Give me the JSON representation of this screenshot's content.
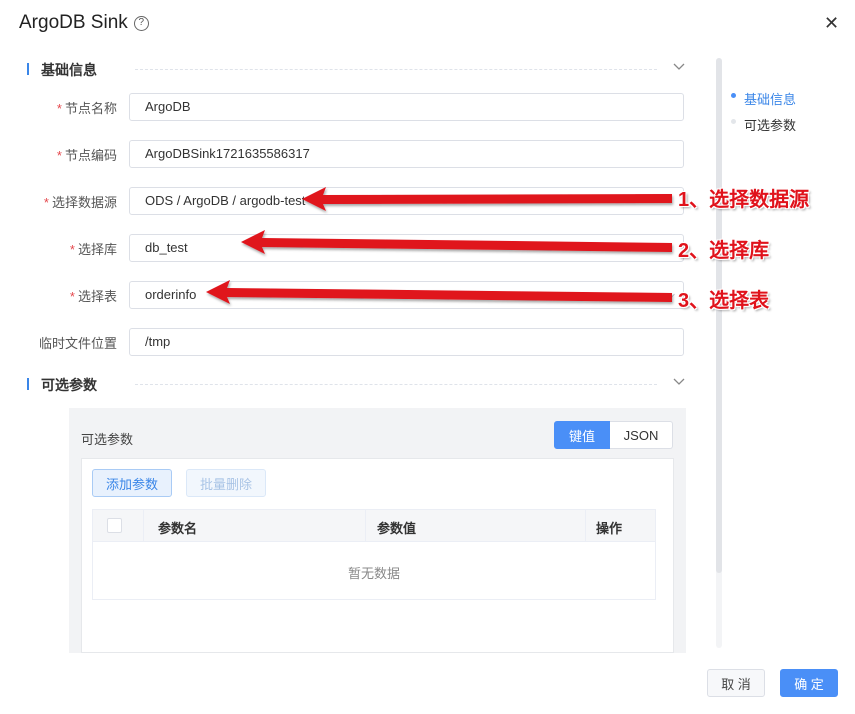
{
  "dialog": {
    "title": "ArgoDB Sink",
    "help_icon": "question-circle-icon",
    "close_icon": "close-icon"
  },
  "sections": {
    "basic": {
      "title": "基础信息"
    },
    "optional": {
      "title": "可选参数"
    }
  },
  "form": {
    "node_name": {
      "label": "节点名称",
      "required": true,
      "value": "ArgoDB"
    },
    "node_code": {
      "label": "节点编码",
      "required": true,
      "value": "ArgoDBSink1721635586317"
    },
    "datasource": {
      "label": "选择数据源",
      "required": true,
      "value": "ODS / ArgoDB / argodb-test"
    },
    "database": {
      "label": "选择库",
      "required": true,
      "value": "db_test"
    },
    "table": {
      "label": "选择表",
      "required": true,
      "value": "orderinfo"
    },
    "temp_path": {
      "label": "临时文件位置",
      "required": false,
      "value": "/tmp"
    }
  },
  "params_panel": {
    "title": "可选参数",
    "mode_keyvalue": "键值",
    "mode_json": "JSON",
    "add_button": "添加参数",
    "batch_delete_button": "批量删除",
    "columns": [
      "参数名",
      "参数值",
      "操作"
    ],
    "empty_text": "暂无数据"
  },
  "anchor_nav": {
    "items": [
      {
        "label": "基础信息",
        "active": true
      },
      {
        "label": "可选参数",
        "active": false
      }
    ]
  },
  "footer": {
    "cancel_label": "取 消",
    "ok_label": "确 定"
  },
  "annotations": [
    {
      "text": "1、选择数据源"
    },
    {
      "text": "2、选择库"
    },
    {
      "text": "3、选择表"
    }
  ],
  "colors": {
    "accent": "#4a8ff7",
    "required": "#e5484d",
    "annotation": "#e0121b"
  }
}
